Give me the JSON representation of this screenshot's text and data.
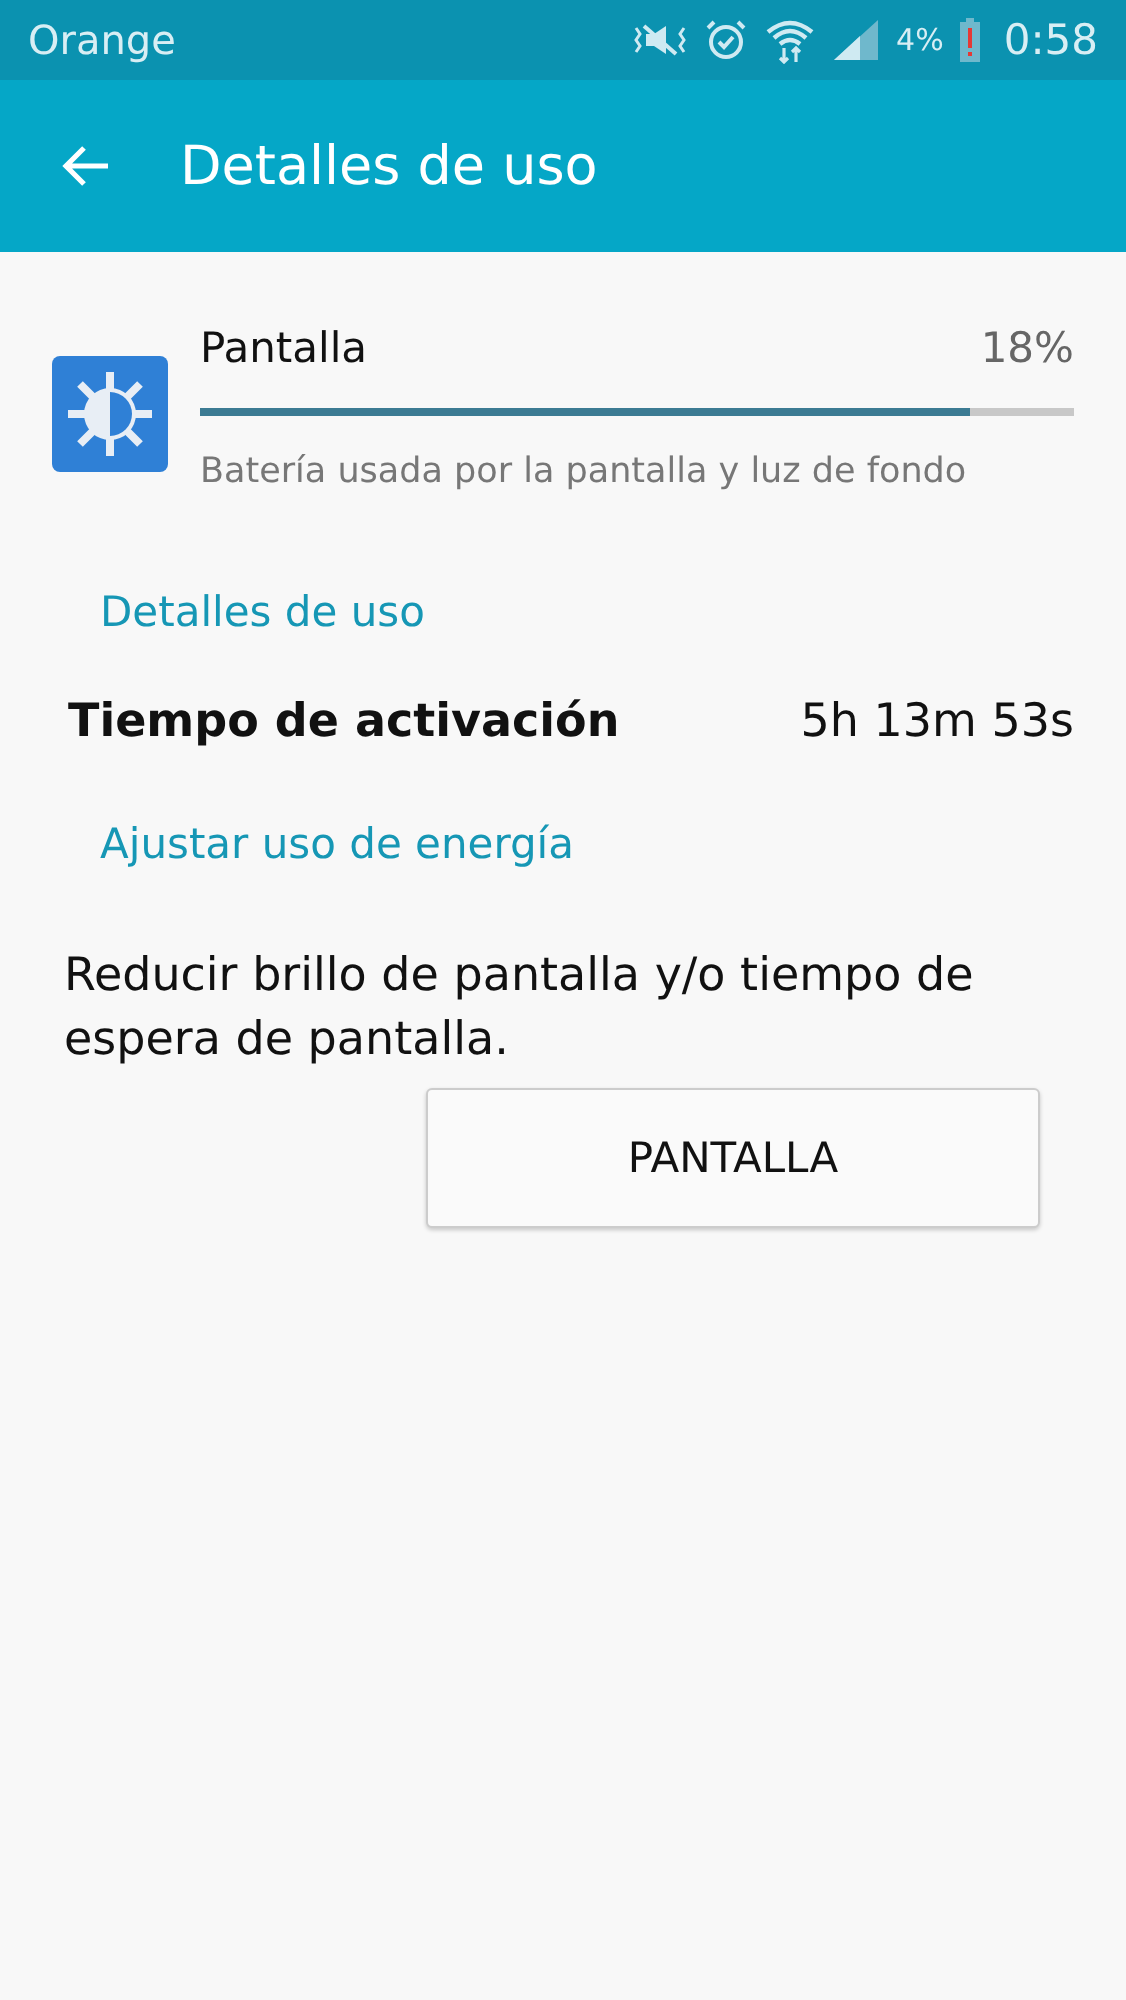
{
  "status_bar": {
    "carrier": "Orange",
    "battery_percent": "4%",
    "time": "0:58"
  },
  "app_bar": {
    "title": "Detalles de uso"
  },
  "usage_item": {
    "name": "Pantalla",
    "percent": "18%",
    "level": 0.88,
    "description": "Batería usada por la pantalla y luz de fondo"
  },
  "details_section": {
    "heading": "Detalles de uso",
    "rows": [
      {
        "label": "Tiempo de activación",
        "value": "5h 13m 53s"
      }
    ]
  },
  "power_section": {
    "heading": "Ajustar uso de energía",
    "text": "Reducir brillo de pantalla y/o tiempo de espera de pantalla.",
    "button": "PANTALLA"
  }
}
